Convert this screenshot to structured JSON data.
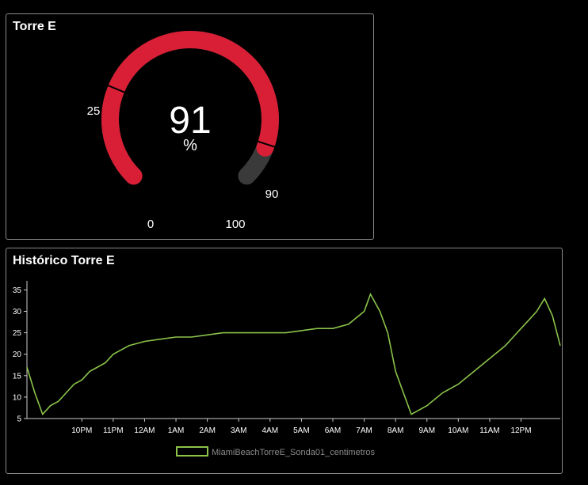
{
  "gauge_panel": {
    "title": "Torre E",
    "value": "91",
    "value_number": 91,
    "unit": "%",
    "min_label": "0",
    "max_label": "100",
    "threshold_low_label": "25",
    "threshold_high_label": "90",
    "threshold_low": 25,
    "threshold_high": 90,
    "min": 0,
    "max": 100,
    "colors": {
      "fill": "#d81f35",
      "track": "#3a3a3a",
      "marker": "#000000"
    }
  },
  "history_panel": {
    "title": "Histórico Torre E",
    "legend_label": "MiamiBeachTorreE_Sonda01_centimetros",
    "colors": {
      "line": "#8bc34a",
      "axis": "#cccccc",
      "text": "#ffffff"
    }
  },
  "chart_data": {
    "type": "line",
    "x_ticks": [
      "10PM",
      "11PM",
      "12AM",
      "1AM",
      "2AM",
      "3AM",
      "4AM",
      "5AM",
      "6AM",
      "7AM",
      "8AM",
      "9AM",
      "10AM",
      "11AM",
      "12PM"
    ],
    "y_ticks": [
      "5",
      "10",
      "15",
      "20",
      "25",
      "30",
      "35"
    ],
    "ylim": [
      5,
      36
    ],
    "x_hours": [
      -1.75,
      15.25
    ],
    "series": [
      {
        "name": "MiamiBeachTorreE_Sonda01_centimetros",
        "x": [
          -1.75,
          -1.5,
          -1.25,
          -1.0,
          -0.75,
          -0.5,
          -0.25,
          0.0,
          0.25,
          0.5,
          0.75,
          1.0,
          1.25,
          1.5,
          2.0,
          2.5,
          3.0,
          3.5,
          4.0,
          4.5,
          5.0,
          5.5,
          6.0,
          6.5,
          7.0,
          7.5,
          8.0,
          8.5,
          9.0,
          9.2,
          9.5,
          9.75,
          10.0,
          10.2,
          10.5,
          10.75,
          11.0,
          11.5,
          12.0,
          12.5,
          13.0,
          13.5,
          13.75,
          14.0,
          14.25,
          14.5,
          14.75,
          15.0,
          15.25
        ],
        "y": [
          17,
          11,
          6,
          8,
          9,
          11,
          13,
          14,
          16,
          17,
          18,
          20,
          21,
          22,
          23,
          23.5,
          24,
          24,
          24.5,
          25,
          25,
          25,
          25,
          25,
          25.5,
          26,
          26,
          27,
          30,
          34,
          30,
          25,
          16,
          12,
          6,
          7,
          8,
          11,
          13,
          16,
          19,
          22,
          24,
          26,
          28,
          30,
          33,
          29,
          22
        ]
      }
    ]
  }
}
